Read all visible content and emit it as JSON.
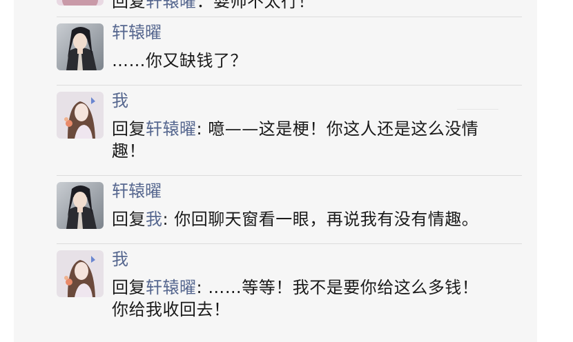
{
  "comments": [
    {
      "author": "",
      "reply_prefix": "回复",
      "reply_to": "轩辕曜",
      "text": "：耍帅不太行！"
    },
    {
      "author": "轩辕曜",
      "text": "……你又缺钱了？"
    },
    {
      "author": "我",
      "reply_prefix": "回复",
      "reply_to": "轩辕曜",
      "text_line1": ": 噫——这是梗！你这人还是这么没情",
      "text_line2": "趣！"
    },
    {
      "author": "轩辕曜",
      "reply_prefix": "回复",
      "reply_to": "我",
      "text": ": 你回聊天窗看一眼，再说我有没有情趣。"
    },
    {
      "author": "我",
      "reply_prefix": "回复",
      "reply_to": "轩辕曜",
      "text_line1": ": ……等等！我不是要你给这么多钱！",
      "text_line2": "你给我收回去！"
    }
  ],
  "colors": {
    "panel_bg": "#f6f6f6",
    "name_color": "#56678f",
    "text_color": "#1a1a1a",
    "divider": "#dcdcdc"
  }
}
